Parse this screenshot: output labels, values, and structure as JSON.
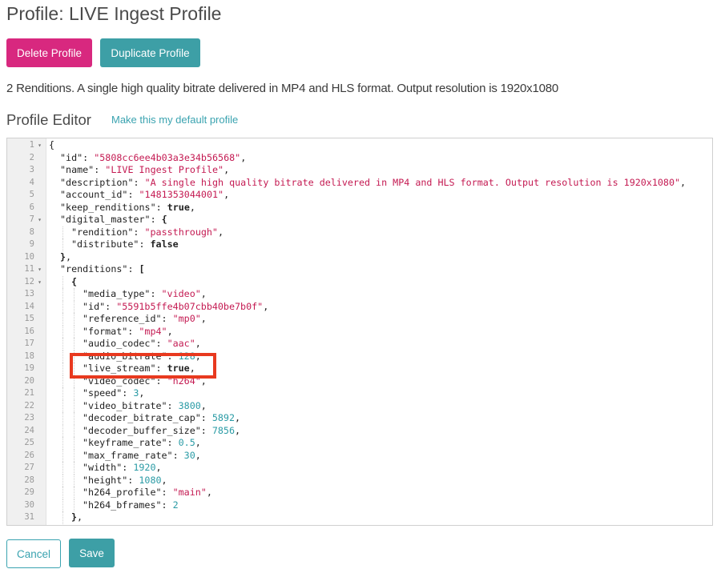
{
  "page": {
    "title": "Profile: LIVE Ingest Profile",
    "description": "2 Renditions. A single high quality bitrate delivered in MP4 and HLS format. Output resolution is 1920x1080"
  },
  "actions": {
    "delete_label": "Delete Profile",
    "duplicate_label": "Duplicate Profile",
    "cancel_label": "Cancel",
    "save_label": "Save"
  },
  "editor": {
    "heading": "Profile Editor",
    "default_link": "Make this my default profile",
    "lines": [
      {
        "n": "1",
        "fold": true,
        "indent": 0,
        "t": [
          [
            "k",
            "{"
          ]
        ]
      },
      {
        "n": "2",
        "indent": 1,
        "t": [
          [
            "k",
            "\"id\": "
          ],
          [
            "s",
            "\"5808cc6ee4b03a3e34b56568\""
          ],
          [
            "k",
            ","
          ]
        ]
      },
      {
        "n": "3",
        "indent": 1,
        "t": [
          [
            "k",
            "\"name\": "
          ],
          [
            "s",
            "\"LIVE Ingest Profile\""
          ],
          [
            "k",
            ","
          ]
        ]
      },
      {
        "n": "4",
        "indent": 1,
        "t": [
          [
            "k",
            "\"description\": "
          ],
          [
            "s",
            "\"A single high quality bitrate delivered in MP4 and HLS format. Output resolution is 1920x1080\""
          ],
          [
            "k",
            ","
          ]
        ]
      },
      {
        "n": "5",
        "indent": 1,
        "t": [
          [
            "k",
            "\"account_id\": "
          ],
          [
            "s",
            "\"1481353044001\""
          ],
          [
            "k",
            ","
          ]
        ]
      },
      {
        "n": "6",
        "indent": 1,
        "t": [
          [
            "k",
            "\"keep_renditions\": "
          ],
          [
            "b",
            "true"
          ],
          [
            "k",
            ","
          ]
        ]
      },
      {
        "n": "7",
        "fold": true,
        "indent": 1,
        "t": [
          [
            "k",
            "\"digital_master\": "
          ],
          [
            "b",
            "{"
          ]
        ]
      },
      {
        "n": "8",
        "indent": 2,
        "t": [
          [
            "k",
            "\"rendition\": "
          ],
          [
            "s",
            "\"passthrough\""
          ],
          [
            "k",
            ","
          ]
        ]
      },
      {
        "n": "9",
        "indent": 2,
        "t": [
          [
            "k",
            "\"distribute\": "
          ],
          [
            "b",
            "false"
          ]
        ]
      },
      {
        "n": "10",
        "indent": 1,
        "t": [
          [
            "b",
            "}"
          ],
          [
            "k",
            ","
          ]
        ]
      },
      {
        "n": "11",
        "fold": true,
        "indent": 1,
        "t": [
          [
            "k",
            "\"renditions\": "
          ],
          [
            "b",
            "["
          ]
        ]
      },
      {
        "n": "12",
        "fold": true,
        "indent": 2,
        "t": [
          [
            "b",
            "{"
          ]
        ]
      },
      {
        "n": "13",
        "indent": 3,
        "t": [
          [
            "k",
            "\"media_type\": "
          ],
          [
            "s",
            "\"video\""
          ],
          [
            "k",
            ","
          ]
        ]
      },
      {
        "n": "14",
        "indent": 3,
        "t": [
          [
            "k",
            "\"id\": "
          ],
          [
            "s",
            "\"5591b5ffe4b07cbb40be7b0f\""
          ],
          [
            "k",
            ","
          ]
        ]
      },
      {
        "n": "15",
        "indent": 3,
        "t": [
          [
            "k",
            "\"reference_id\": "
          ],
          [
            "s",
            "\"mp0\""
          ],
          [
            "k",
            ","
          ]
        ]
      },
      {
        "n": "16",
        "indent": 3,
        "t": [
          [
            "k",
            "\"format\": "
          ],
          [
            "s",
            "\"mp4\""
          ],
          [
            "k",
            ","
          ]
        ]
      },
      {
        "n": "17",
        "indent": 3,
        "t": [
          [
            "k",
            "\"audio_codec\": "
          ],
          [
            "s",
            "\"aac\""
          ],
          [
            "k",
            ","
          ]
        ]
      },
      {
        "n": "18",
        "indent": 3,
        "t": [
          [
            "k",
            "\"audio_bitrate\": "
          ],
          [
            "n",
            "128"
          ],
          [
            "k",
            ","
          ]
        ]
      },
      {
        "n": "19",
        "indent": 3,
        "t": [
          [
            "k",
            "\"live_stream\": "
          ],
          [
            "b",
            "true"
          ],
          [
            "k",
            ","
          ]
        ]
      },
      {
        "n": "20",
        "indent": 3,
        "t": [
          [
            "k",
            "\"video_codec\": "
          ],
          [
            "s",
            "\"h264\""
          ],
          [
            "k",
            ","
          ]
        ]
      },
      {
        "n": "21",
        "indent": 3,
        "t": [
          [
            "k",
            "\"speed\": "
          ],
          [
            "n",
            "3"
          ],
          [
            "k",
            ","
          ]
        ]
      },
      {
        "n": "22",
        "indent": 3,
        "t": [
          [
            "k",
            "\"video_bitrate\": "
          ],
          [
            "n",
            "3800"
          ],
          [
            "k",
            ","
          ]
        ]
      },
      {
        "n": "23",
        "indent": 3,
        "t": [
          [
            "k",
            "\"decoder_bitrate_cap\": "
          ],
          [
            "n",
            "5892"
          ],
          [
            "k",
            ","
          ]
        ]
      },
      {
        "n": "24",
        "indent": 3,
        "t": [
          [
            "k",
            "\"decoder_buffer_size\": "
          ],
          [
            "n",
            "7856"
          ],
          [
            "k",
            ","
          ]
        ]
      },
      {
        "n": "25",
        "indent": 3,
        "t": [
          [
            "k",
            "\"keyframe_rate\": "
          ],
          [
            "n",
            "0.5"
          ],
          [
            "k",
            ","
          ]
        ]
      },
      {
        "n": "26",
        "indent": 3,
        "t": [
          [
            "k",
            "\"max_frame_rate\": "
          ],
          [
            "n",
            "30"
          ],
          [
            "k",
            ","
          ]
        ]
      },
      {
        "n": "27",
        "indent": 3,
        "t": [
          [
            "k",
            "\"width\": "
          ],
          [
            "n",
            "1920"
          ],
          [
            "k",
            ","
          ]
        ]
      },
      {
        "n": "28",
        "indent": 3,
        "t": [
          [
            "k",
            "\"height\": "
          ],
          [
            "n",
            "1080"
          ],
          [
            "k",
            ","
          ]
        ]
      },
      {
        "n": "29",
        "indent": 3,
        "t": [
          [
            "k",
            "\"h264_profile\": "
          ],
          [
            "s",
            "\"main\""
          ],
          [
            "k",
            ","
          ]
        ]
      },
      {
        "n": "30",
        "indent": 3,
        "t": [
          [
            "k",
            "\"h264_bframes\": "
          ],
          [
            "n",
            "2"
          ]
        ]
      },
      {
        "n": "31",
        "indent": 2,
        "t": [
          [
            "b",
            "}"
          ],
          [
            "k",
            ","
          ]
        ]
      }
    ]
  },
  "colors": {
    "delete": "#d8287f",
    "primary": "#3d9fa6",
    "link": "#3aa3b0",
    "string": "#c41a52",
    "number": "#2a9ba5",
    "highlight": "#e8391f"
  }
}
